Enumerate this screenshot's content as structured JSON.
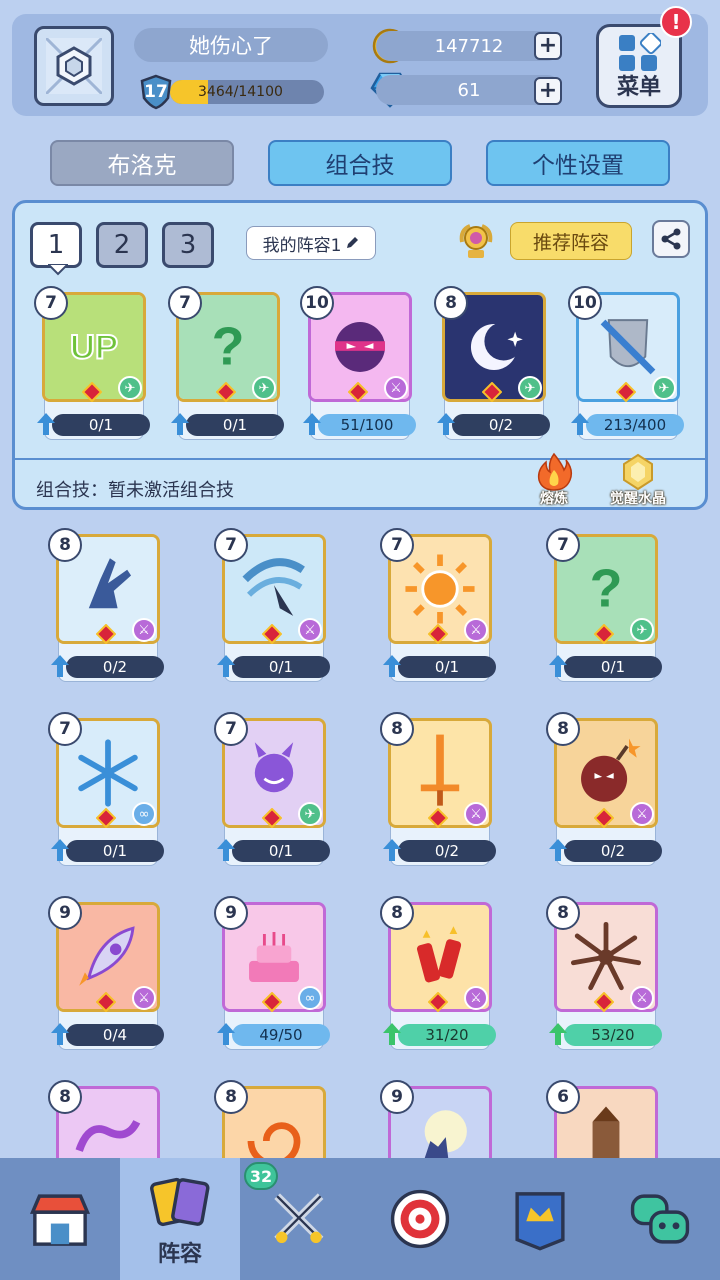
{
  "player": {
    "name": "她伤心了",
    "level": "17",
    "xp_text": "3464/14100",
    "xp_fraction": 0.246
  },
  "currency": {
    "coins": "147712",
    "gems": "61"
  },
  "menu": {
    "label": "菜单",
    "alert": "!"
  },
  "top_tabs": [
    {
      "label": "布洛克",
      "state": "inactive"
    },
    {
      "label": "组合技",
      "state": "active"
    },
    {
      "label": "个性设置",
      "state": "active"
    }
  ],
  "lineup": {
    "slots": [
      "1",
      "2",
      "3"
    ],
    "selected_slot": "1",
    "name": "我的阵容1",
    "recommend_label": "推荐阵容",
    "combo_text": "组合技：暂未激活组合技",
    "smelt_label": "熔炼",
    "crystal_label": "觉醒水晶",
    "cards": [
      {
        "rank": "7",
        "progress": "0/1",
        "icon": "up-icon",
        "badge": "wing"
      },
      {
        "rank": "7",
        "progress": "0/1",
        "icon": "question-icon",
        "badge": "wing"
      },
      {
        "rank": "10",
        "progress": "51/100",
        "icon": "ninja-ball-icon",
        "badge": "sword"
      },
      {
        "rank": "8",
        "progress": "0/2",
        "icon": "moon-icon",
        "badge": "wing"
      },
      {
        "rank": "10",
        "progress": "213/400",
        "icon": "shield-sword-icon",
        "badge": "wing"
      }
    ]
  },
  "collection": [
    {
      "rank": "8",
      "progress": "0/2",
      "icon": "hand-icon",
      "badge": "sword"
    },
    {
      "rank": "7",
      "progress": "0/1",
      "icon": "whirlwind-icon",
      "badge": "sword"
    },
    {
      "rank": "7",
      "progress": "0/1",
      "icon": "sun-icon",
      "badge": "sword"
    },
    {
      "rank": "7",
      "progress": "0/1",
      "icon": "question-icon",
      "badge": "wing"
    },
    {
      "rank": "7",
      "progress": "0/1",
      "icon": "snowflake-icon",
      "badge": "link"
    },
    {
      "rank": "7",
      "progress": "0/1",
      "icon": "demon-icon",
      "badge": "wing"
    },
    {
      "rank": "8",
      "progress": "0/2",
      "icon": "greatsword-icon",
      "badge": "sword"
    },
    {
      "rank": "8",
      "progress": "0/2",
      "icon": "bomb-icon",
      "badge": "sword"
    },
    {
      "rank": "9",
      "progress": "0/4",
      "icon": "rocket-icon",
      "badge": "sword"
    },
    {
      "rank": "9",
      "progress": "49/50",
      "icon": "cake-icon",
      "badge": "link"
    },
    {
      "rank": "8",
      "progress": "31/20",
      "icon": "firecracker-icon",
      "badge": "sword"
    },
    {
      "rank": "8",
      "progress": "53/20",
      "icon": "burst-icon",
      "badge": "sword"
    },
    {
      "rank": "8",
      "progress": "",
      "icon": "tentacle-icon",
      "badge": ""
    },
    {
      "rank": "8",
      "progress": "",
      "icon": "swirl-icon",
      "badge": ""
    },
    {
      "rank": "9",
      "progress": "",
      "icon": "wolf-moon-icon",
      "badge": ""
    },
    {
      "rank": "6",
      "progress": "",
      "icon": "tree-icon",
      "badge": ""
    }
  ],
  "bottom_nav": [
    {
      "label": "",
      "icon": "shop-icon"
    },
    {
      "label": "阵容",
      "icon": "cards-icon",
      "badge": "32"
    },
    {
      "label": "",
      "icon": "battle-icon"
    },
    {
      "label": "",
      "icon": "target-icon"
    },
    {
      "label": "",
      "icon": "banner-icon"
    },
    {
      "label": "",
      "icon": "chat-icon"
    }
  ],
  "colors": {
    "background": "#bcd0f0",
    "panel": "#cbe5f8",
    "accent_blue": "#6ec4f0",
    "gold": "#f6c52a",
    "ready_green": "#4fd0a8"
  }
}
